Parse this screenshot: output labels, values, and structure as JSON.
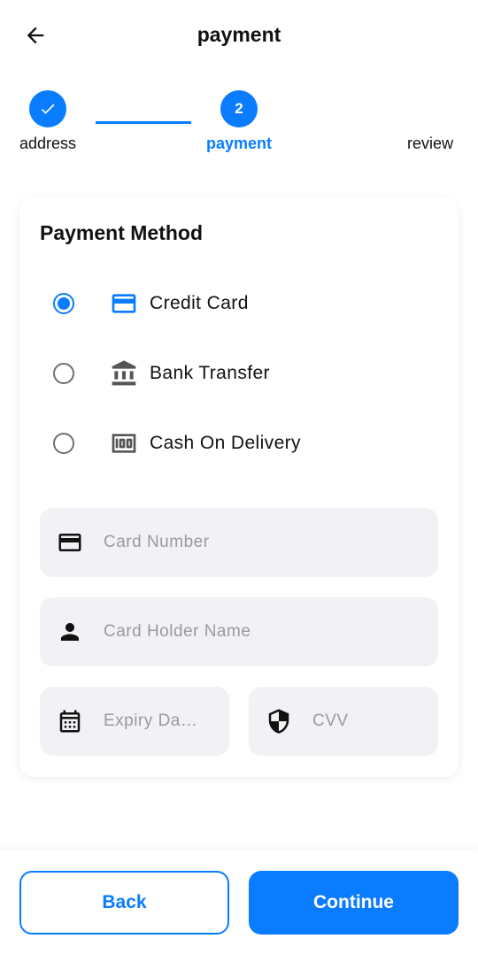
{
  "header": {
    "title": "payment",
    "back_icon": "arrow-left-icon"
  },
  "stepper": {
    "steps": [
      {
        "label": "address",
        "state": "completed",
        "badge": ""
      },
      {
        "label": "payment",
        "state": "active",
        "badge": "2"
      },
      {
        "label": "review",
        "state": "pending",
        "badge": ""
      }
    ]
  },
  "payment_method": {
    "title": "Payment Method",
    "options": [
      {
        "label": "Credit Card",
        "icon": "credit-card-icon",
        "selected": true
      },
      {
        "label": "Bank Transfer",
        "icon": "bank-icon",
        "selected": false
      },
      {
        "label": "Cash On Delivery",
        "icon": "cash-icon",
        "selected": false
      }
    ]
  },
  "form": {
    "card_number": {
      "placeholder": "Card Number",
      "value": "",
      "icon": "credit-card-icon"
    },
    "card_holder": {
      "placeholder": "Card Holder Name",
      "value": "",
      "icon": "person-icon"
    },
    "expiry": {
      "placeholder": "Expiry Da…",
      "value": "",
      "icon": "calendar-icon"
    },
    "cvv": {
      "placeholder": "CVV",
      "value": "",
      "icon": "shield-icon"
    }
  },
  "actions": {
    "back_label": "Back",
    "continue_label": "Continue"
  },
  "colors": {
    "accent": "#0a7cff",
    "field_bg": "#f2f2f6",
    "placeholder": "#9a9a9e"
  }
}
